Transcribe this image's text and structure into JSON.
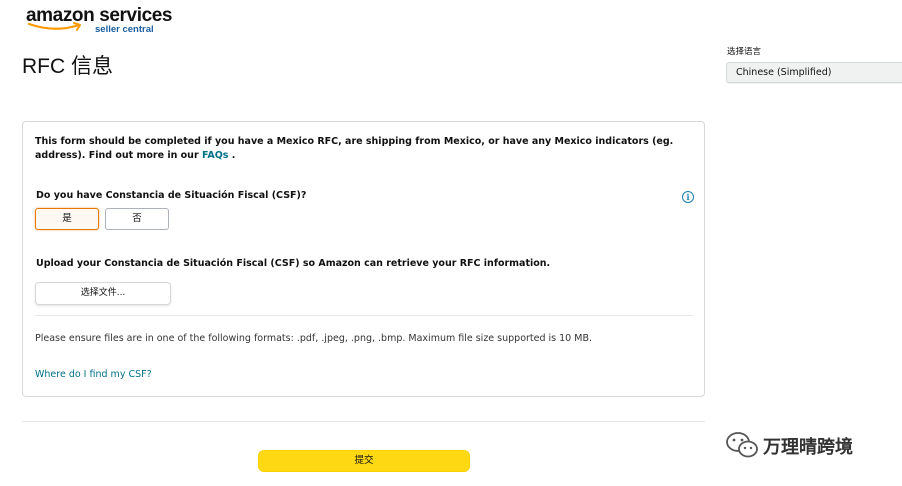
{
  "logo": {
    "brand": "amazon services",
    "subtitle": "seller central"
  },
  "page_title": "RFC 信息",
  "language": {
    "label": "选择语言",
    "selected": "Chinese (Simplified)"
  },
  "form": {
    "intro_text": "This form should be completed if you have a Mexico RFC, are shipping from Mexico, or have any Mexico indicators (eg. address). Find out more in our",
    "faqs_link": "FAQs",
    "intro_end": " .",
    "csf_question": "Do you have Constancia de Situación Fiscal (CSF)?",
    "yes_label": "是",
    "no_label": "否",
    "selected_option": "yes",
    "upload_label": "Upload your Constancia de Situación Fiscal (CSF) so Amazon can retrieve your RFC information.",
    "choose_file_label": "选择文件...",
    "formats_note": "Please ensure files are in one of the following formats: .pdf, .jpeg, .png, .bmp. Maximum file size supported is 10 MB.",
    "where_link": "Where do I find my CSF?"
  },
  "submit_label": "提交",
  "watermark": {
    "text": "万理晴跨境",
    "icon": "wechat-icon"
  },
  "colors": {
    "accent_orange": "#e77600",
    "link_teal": "#007185",
    "submit_yellow": "#ffd814"
  }
}
